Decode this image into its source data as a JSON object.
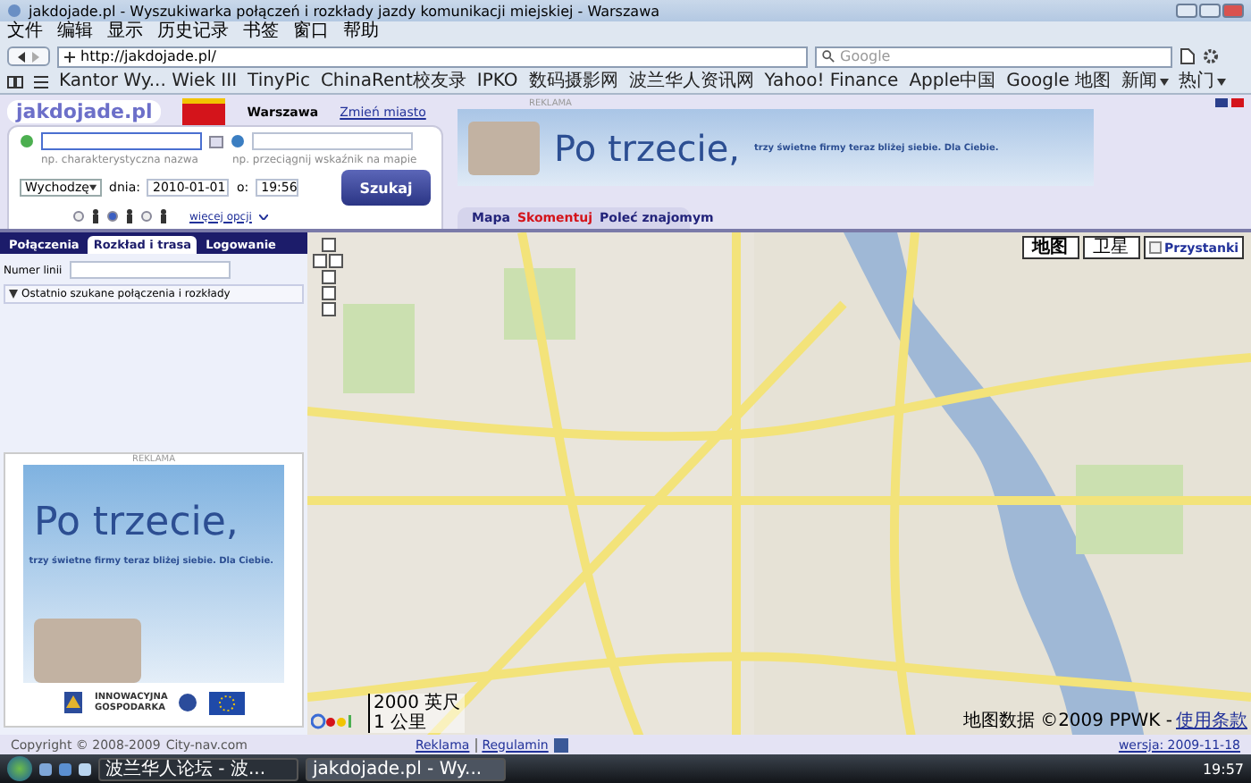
{
  "window": {
    "title": "jakdojade.pl - Wyszukiwarka połączeń i rozkłady jazdy komunikacji miejskiej - Warszawa"
  },
  "menu": [
    "文件",
    "编辑",
    "显示",
    "历史记录",
    "书签",
    "窗口",
    "帮助"
  ],
  "address": {
    "url": "http://jakdojade.pl/",
    "search_placeholder": "Google"
  },
  "bookmarks": [
    {
      "label": "Kantor Wy... Wiek III",
      "menu": false
    },
    {
      "label": "TinyPic",
      "menu": false
    },
    {
      "label": "ChinaRent校友录",
      "menu": false
    },
    {
      "label": "IPKO",
      "menu": false
    },
    {
      "label": "数码摄影网",
      "menu": false
    },
    {
      "label": "波兰华人资讯网",
      "menu": false
    },
    {
      "label": "Yahoo! Finance",
      "menu": false
    },
    {
      "label": "Apple中国",
      "menu": false
    },
    {
      "label": "Google 地图",
      "menu": false
    },
    {
      "label": "新闻",
      "menu": true
    },
    {
      "label": "热门",
      "menu": true
    }
  ],
  "header": {
    "logo": "jakdojade.pl",
    "city": "Warszawa",
    "change_city": "Zmień miasto",
    "from_hint": "np. charakterystyczna nazwa",
    "to_hint": "np. przeciągnij wskaźnik na mapie",
    "mode": "Wychodzę",
    "date_label": "dnia:",
    "date": "2010-01-01",
    "time_label": "o:",
    "time": "19:56",
    "search_button": "Szukaj",
    "more": "więcej opcji",
    "travellers": [
      {
        "selected": false
      },
      {
        "selected": true
      },
      {
        "selected": false
      }
    ]
  },
  "ad_top": {
    "label": "REKLAMA",
    "headline": "Po trzecie,",
    "tagline": "trzy świetne firmy teraz bliżej siebie. Dla Ciebie."
  },
  "map_tabs": [
    {
      "label": "Mapa",
      "kind": "tab"
    },
    {
      "label": "Skomentuj",
      "kind": "alert"
    },
    {
      "label": "Poleć znajomym",
      "kind": "tab"
    }
  ],
  "panel_tabs": [
    {
      "label": "Połączenia",
      "selected": false
    },
    {
      "label": "Rozkład i trasa",
      "selected": true
    },
    {
      "label": "Logowanie",
      "selected": false
    }
  ],
  "line_field": {
    "label": "Numer linii"
  },
  "recent": {
    "label": "Ostatnio szukane połączenia i rozkłady",
    "expanded": true
  },
  "ad_side": {
    "label": "REKLAMA",
    "headline": "Po trzecie,",
    "tagline": "trzy świetne firmy teraz bliżej siebie. Dla Ciebie."
  },
  "eu_logo": "INNOWACYJNA GOSPODARKA",
  "map": {
    "types": [
      {
        "label": "地图",
        "selected": true
      },
      {
        "label": "卫星",
        "selected": false
      }
    ],
    "stops": {
      "label": "Przystanki",
      "checked": false
    },
    "scale": [
      "2000 英尺",
      "1 公里"
    ],
    "attribution": "地图数据 ©2009 PPWK -",
    "terms": "使用条款"
  },
  "footer": {
    "copyright": "Copyright © 2008-2009",
    "brand": "City-nav.com",
    "links": [
      "Reklama",
      "Regulamin"
    ],
    "version": "wersja: 2009-11-18"
  },
  "taskbar": {
    "tasks": [
      {
        "label": "波兰华人论坛 - 波...",
        "active": false
      },
      {
        "label": "jakdojade.pl - Wy...",
        "active": true
      }
    ],
    "clock": "19:57"
  }
}
